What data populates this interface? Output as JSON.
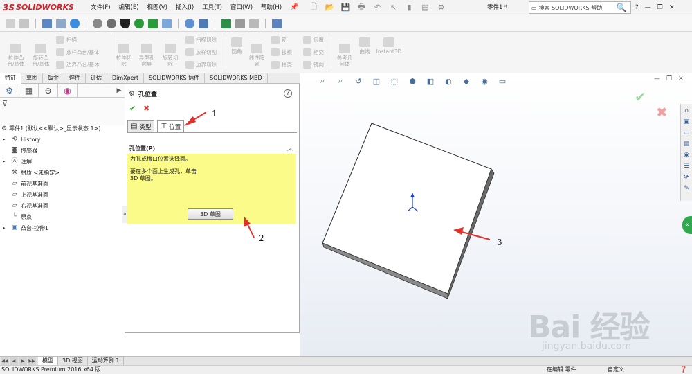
{
  "app": {
    "logo_text": "SOLIDWORKS",
    "logo_mark": "3S"
  },
  "menus": [
    "文件(F)",
    "编辑(E)",
    "视图(V)",
    "插入(I)",
    "工具(T)",
    "窗口(W)",
    "帮助(H)"
  ],
  "doc_title": "零件1 *",
  "search": {
    "value": "搜索 SOLIDWORKS 帮助"
  },
  "window_controls": {
    "help": "?",
    "minimize": "—",
    "restore": "❐",
    "close": "✕"
  },
  "commands": {
    "extrude_boss": "拉伸凸\n台/基体",
    "revolve_boss": "旋转凸\n台/基体",
    "sweep": "扫描",
    "loft": "放样凸台/基体",
    "boundary": "边界凸台/基体",
    "extrude_cut": "拉伸切\n除",
    "hole_wizard": "异型孔\n向导",
    "revolve_cut": "旋转切\n除",
    "swept_cut": "扫描切除",
    "lofted_cut": "放样切割",
    "boundary_cut": "边界切除",
    "fillet": "圆角",
    "linear_pattern": "线性阵\n列",
    "rib": "筋",
    "draft": "拔模",
    "shell": "抽壳",
    "wrap": "包覆",
    "intersect": "相交",
    "mirror": "镜向",
    "ref_geometry": "参考几\n何体",
    "curves": "曲线",
    "instant3d": "Instant3D"
  },
  "tabs": [
    "特征",
    "草图",
    "钣金",
    "焊件",
    "评估",
    "DimXpert",
    "SOLIDWORKS 插件",
    "SOLIDWORKS MBD"
  ],
  "tree": {
    "root": "零件1 (默认<<默认>_显示状态 1>)",
    "items": [
      "History",
      "传感器",
      "注解",
      "材质 <未指定>",
      "前视基准面",
      "上视基准面",
      "右视基准面",
      "原点",
      "凸台-拉伸1"
    ]
  },
  "pm": {
    "title": "孔位置",
    "help": "?",
    "tab_type": "类型",
    "tab_position": "位置",
    "group_title": "孔位置(P)",
    "msg1": "为孔或槽口位置选择面。",
    "msg2": "要在多个面上生成孔，单击\n3D 草图。",
    "button": "3D 草图"
  },
  "annotations": [
    "1",
    "2",
    "3"
  ],
  "watermark": {
    "main": "Bai 经验",
    "sub": "jingyan.baidu.com"
  },
  "bottom_tabs": [
    "模型",
    "3D 视图",
    "运动算例 1"
  ],
  "status": {
    "left": "SOLIDWORKS Premium 2016 x64 版",
    "edit": "在编辑 零件",
    "units": "自定义",
    "help_icon": "❓"
  },
  "colors": {
    "accent_red": "#d3232a",
    "message_yellow": "#fbfb8a",
    "ok_green": "#2ba02b",
    "annotation_red": "#e3302a"
  }
}
